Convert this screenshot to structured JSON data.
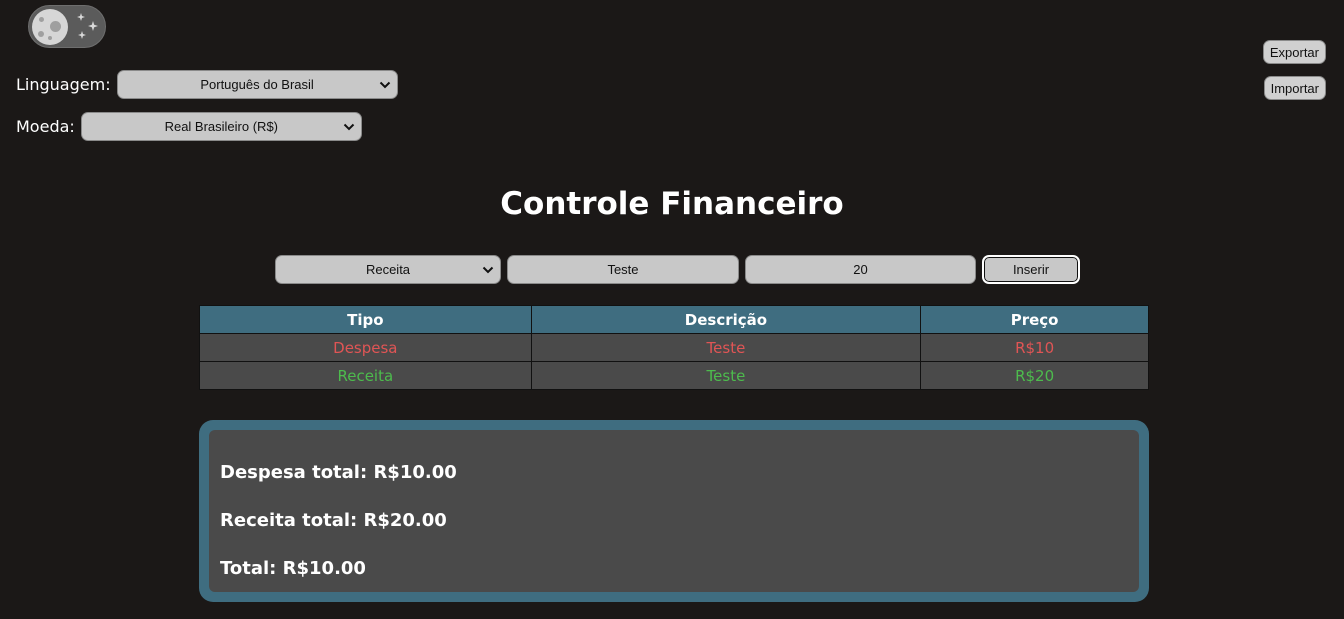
{
  "settings": {
    "language_label": "Linguagem:",
    "language_value": "Português do Brasil",
    "currency_label": "Moeda:",
    "currency_value": "Real Brasileiro (R$)"
  },
  "actions": {
    "export_label": "Exportar",
    "import_label": "Importar"
  },
  "page": {
    "title": "Controle Financeiro"
  },
  "form": {
    "type_value": "Receita",
    "description_value": "Teste",
    "price_value": "20",
    "insert_label": "Inserir"
  },
  "table": {
    "headers": [
      "Tipo",
      "Descrição",
      "Preço"
    ],
    "rows": [
      {
        "type": "Despesa",
        "description": "Teste",
        "price": "R$10"
      },
      {
        "type": "Receita",
        "description": "Teste",
        "price": "R$20"
      }
    ]
  },
  "summary": {
    "expense_total": "Despesa total: R$10.00",
    "income_total": "Receita total: R$20.00",
    "total": "Total: R$10.00"
  },
  "colors": {
    "background": "#1b1817",
    "accent": "#3f6d80",
    "expense": "#e05555",
    "income": "#4dbb4d"
  },
  "icons": {
    "theme_toggle": "moon-icon",
    "dropdown": "chevron-down-icon"
  }
}
